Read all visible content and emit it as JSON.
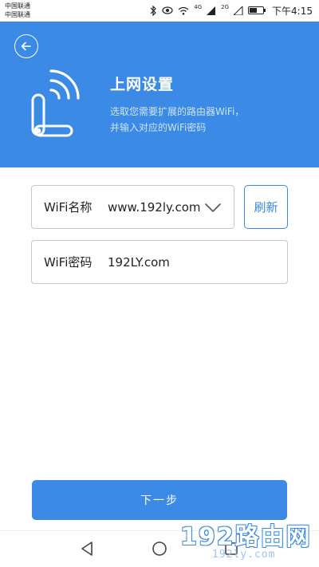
{
  "status_bar": {
    "carrier_1": "中国联通",
    "carrier_2": "中国联通",
    "network_1": "4G",
    "network_2": "2G",
    "time": "下午4:15",
    "icons": [
      "bluetooth-icon",
      "eye-icon",
      "wifi-icon",
      "signal-icon",
      "battery-icon"
    ]
  },
  "header": {
    "title": "上网设置",
    "description_line1": "选取您需要扩展的路由器WiFi，",
    "description_line2": "并输入对应的WiFi密码",
    "background_color": "#3a8ae6",
    "back_icon": "back-arrow-circle-icon",
    "illustration_icon": "router-wifi-icon"
  },
  "form": {
    "ssid_label": "WiFi名称",
    "ssid_value": "www.192ly.com",
    "password_label": "WiFi密码",
    "password_value": "192LY.com",
    "refresh_label": "刷新"
  },
  "next_button": {
    "label": "下一步"
  },
  "nav_bar": {
    "icons": [
      "nav-back-icon",
      "nav-home-icon",
      "nav-recent-icon"
    ]
  },
  "watermark": {
    "big_text": "192路由网",
    "small_text": "192ly.com"
  },
  "colors": {
    "accent": "#3a8ae6",
    "text_primary": "#222222",
    "border": "#c8c8c8"
  }
}
